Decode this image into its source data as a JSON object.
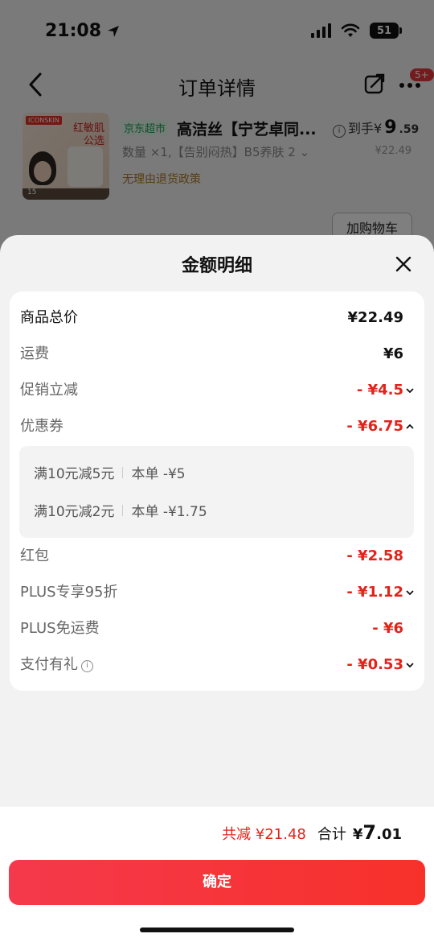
{
  "status": {
    "time": "21:08",
    "battery": "51"
  },
  "nav": {
    "title": "订单详情",
    "badge": "5+"
  },
  "product": {
    "thumb_tag": "ICONSKIN",
    "thumb_text": "红敏肌\n公选",
    "thumb_bottom": "15",
    "store_tag": "京东超市",
    "name": "高洁丝【宁艺卓同...",
    "price_prefix": "到手¥",
    "price_int": "9",
    "price_dec": ".59",
    "spec": "数量 ×1,【告别闷热】B5养肤 2",
    "orig_price": "¥22.49",
    "return_policy": "无理由退货政策",
    "cart_button": "加购物车"
  },
  "sheet": {
    "title": "金额明细",
    "rows": [
      {
        "label": "商品总价",
        "value": "¥22.49"
      },
      {
        "label": "运费",
        "value": "¥6"
      },
      {
        "label": "促销立减",
        "value": "- ¥4.5"
      },
      {
        "label": "优惠券",
        "value": "- ¥6.75"
      },
      {
        "label": "红包",
        "value": "- ¥2.58"
      },
      {
        "label": "PLUS专享95折",
        "value": "- ¥1.12"
      },
      {
        "label": "PLUS免运费",
        "value": "- ¥6"
      },
      {
        "label": "支付有礼",
        "value": "- ¥0.53"
      }
    ],
    "coupons": [
      {
        "name": "满10元减5元",
        "detail": "本单 -¥5"
      },
      {
        "name": "满10元减2元",
        "detail": "本单 -¥1.75"
      }
    ]
  },
  "footer": {
    "saved_label": "共减 ¥21.48",
    "total_label": "合计",
    "total_currency": "¥",
    "total_int": "7",
    "total_dec": ".01",
    "confirm": "确定"
  },
  "colors": {
    "accent": "#e2231a",
    "button": "#f5394c"
  }
}
